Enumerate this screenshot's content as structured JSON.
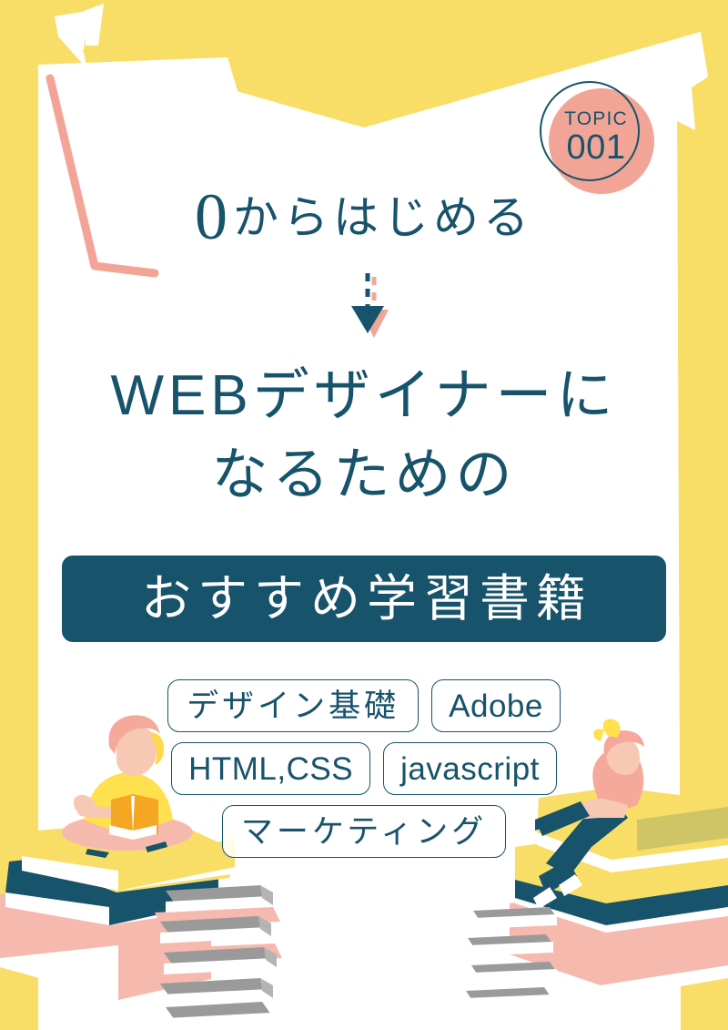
{
  "poster": {
    "background_color": "#F8DE67",
    "card_color": "#FFFFFF",
    "accent_navy": "#17536B",
    "accent_pink": "#F2A596",
    "accent_yellow": "#F8DE67",
    "accent_orange": "#F5B731"
  },
  "badge": {
    "label": "TOPIC",
    "number": "001",
    "circle_fill": "#F2A596",
    "circle_stroke": "#17536B"
  },
  "kicker": {
    "zero": "0",
    "rest": "からはじめる"
  },
  "title": {
    "line1": "WEBデザイナーに",
    "line2": "なるための"
  },
  "banner": {
    "text": "おすすめ学習書籍",
    "background": "#17536B",
    "color": "#FFFFFF"
  },
  "tags": {
    "rows": [
      [
        {
          "label": "デザイン基礎",
          "script": "jp"
        },
        {
          "label": "Adobe",
          "script": "latin"
        }
      ],
      [
        {
          "label": "HTML,CSS",
          "script": "latin"
        },
        {
          "label": "javascript",
          "script": "latin"
        }
      ],
      [
        {
          "label": "マーケティング",
          "script": "jp"
        }
      ]
    ]
  },
  "decorations": {
    "open_book_icon": "open-book-shape",
    "arrow_icon": "dashed-down-arrow",
    "corner_line_icon": "pink-corner-line",
    "page_flourish_icon": "page-flourish",
    "left_illustration": "person-reading-on-book-stack",
    "right_illustration": "person-sitting-on-book-stack",
    "center_illustration": "gray-book-stack"
  }
}
